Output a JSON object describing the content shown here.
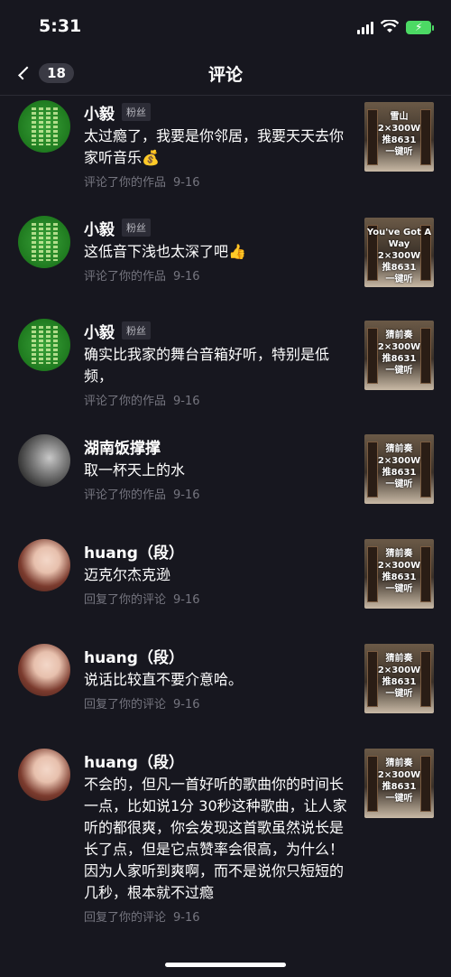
{
  "status": {
    "time": "5:31"
  },
  "nav": {
    "back_count": "18",
    "title": "评论"
  },
  "comments": [
    {
      "name": "小毅",
      "tag": "粉丝",
      "text": "太过瘾了，我要是你邻居，我要天天去你家听音乐💰",
      "action": "评论了你的作品",
      "date": "9-16",
      "avatar": "green-calligraphy-avatar",
      "thumb_text": [
        "雪山",
        "2×300W",
        "推8631",
        "一键听"
      ]
    },
    {
      "name": "小毅",
      "tag": "粉丝",
      "text": "这低音下浅也太深了吧👍",
      "action": "评论了你的作品",
      "date": "9-16",
      "avatar": "green-calligraphy-avatar",
      "thumb_text": [
        "You've Got A Way",
        "2×300W",
        "推8631",
        "一键听"
      ]
    },
    {
      "name": "小毅",
      "tag": "粉丝",
      "text": "确实比我家的舞台音箱好听，特别是低频，",
      "action": "评论了你的作品",
      "date": "9-16",
      "avatar": "green-calligraphy-avatar",
      "thumb_text": [
        "猜前奏",
        "2×300W",
        "推8631",
        "一键听"
      ]
    },
    {
      "name": "湖南饭撑撑",
      "tag": "",
      "text": "取一杯天上的水",
      "action": "评论了你的作品",
      "date": "9-16",
      "avatar": "grayscale-avatar",
      "thumb_text": [
        "猜前奏",
        "2×300W",
        "推8631",
        "一键听"
      ]
    },
    {
      "name": "huang（段）",
      "tag": "",
      "text": "迈克尔杰克逊",
      "action": "回复了你的评论",
      "date": "9-16",
      "avatar": "portrait-avatar",
      "thumb_text": [
        "猜前奏",
        "2×300W",
        "推8631",
        "一键听"
      ]
    },
    {
      "name": "huang（段）",
      "tag": "",
      "text": "说话比较直不要介意哈。",
      "action": "回复了你的评论",
      "date": "9-16",
      "avatar": "portrait-avatar",
      "thumb_text": [
        "猜前奏",
        "2×300W",
        "推8631",
        "一键听"
      ]
    },
    {
      "name": "huang（段）",
      "tag": "",
      "text": "不会的，但凡一首好听的歌曲你的时间长一点，比如说1分 30秒这种歌曲，让人家听的都很爽，你会发现这首歌虽然说长是长了点，但是它点赞率会很高，为什么！因为人家听到爽啊，而不是说你只短短的几秒，根本就不过瘾",
      "action": "回复了你的评论",
      "date": "9-16",
      "avatar": "portrait-avatar",
      "thumb_text": [
        "猜前奏",
        "2×300W",
        "推8631",
        "一键听"
      ]
    }
  ]
}
